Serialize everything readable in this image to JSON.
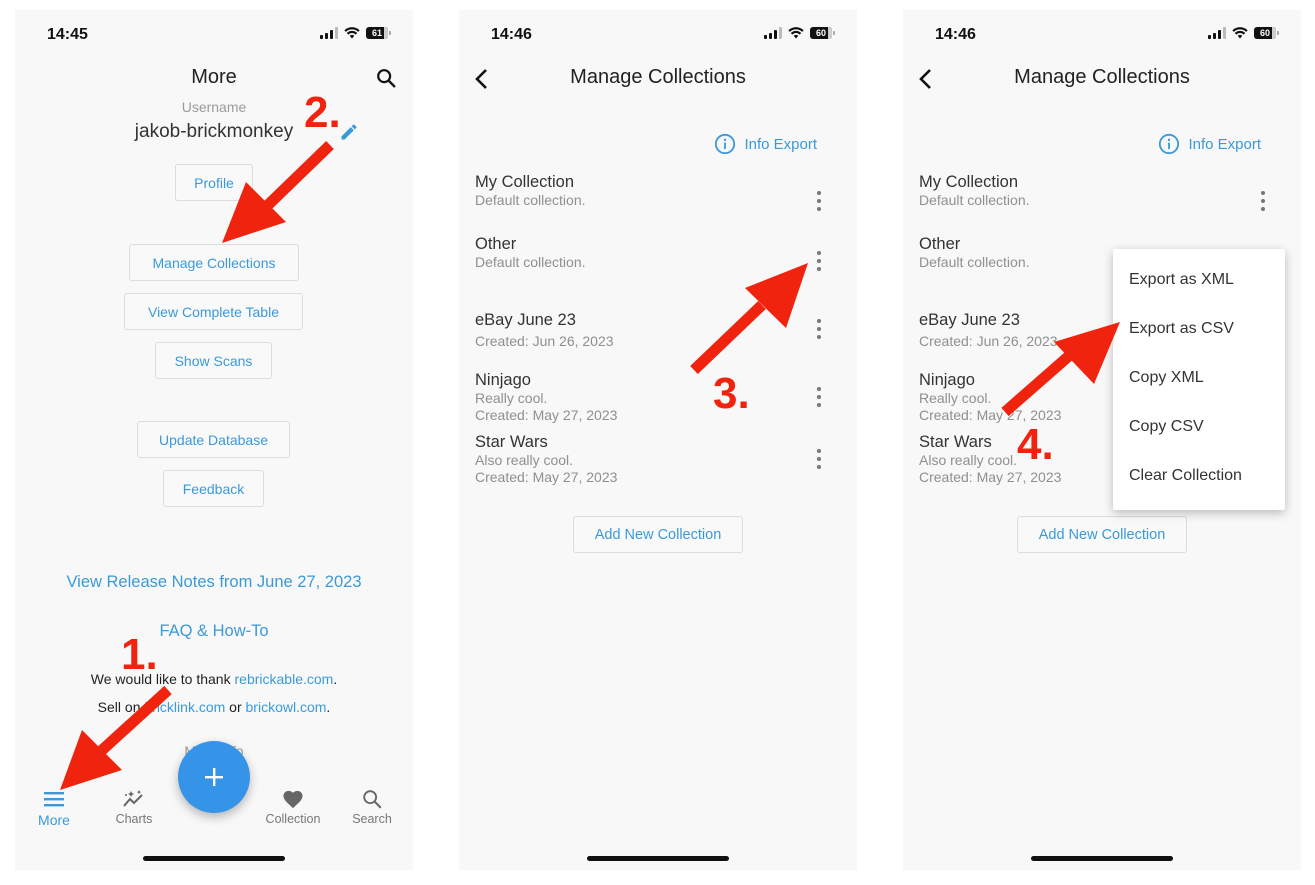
{
  "colors": {
    "accent": "#3a9ad9",
    "fab": "#3593e8",
    "annotation": "#f0230e",
    "screen_bg": "#f8f8f8",
    "muted_text": "#8f8f8f"
  },
  "screens": [
    {
      "status": {
        "time": "14:45",
        "battery": "61"
      },
      "header": {
        "title": "More",
        "search_icon": "search-icon"
      },
      "profile": {
        "username_label": "Username",
        "username": "jakob-brickmonkey",
        "edit_icon": "pencil-icon"
      },
      "buttons": {
        "profile": "Profile",
        "manage_collections": "Manage Collections",
        "view_complete_table": "View Complete Table",
        "show_scans": "Show Scans",
        "update_database": "Update Database",
        "feedback": "Feedback"
      },
      "links": {
        "release_notes": "View Release Notes from June 27, 2023",
        "faq": "FAQ & How-To"
      },
      "credits": {
        "thanks_prefix": "We would like to thank ",
        "thanks_link": "rebrickable.com",
        "thanks_suffix": ".",
        "sell_prefix": "Sell on ",
        "sell_link1": "bricklink.com",
        "sell_mid": " or ",
        "sell_link2": "brickowl.com",
        "sell_suffix": "."
      },
      "more_info": "More Info",
      "bottom_nav": [
        {
          "label": "More",
          "icon": "menu-icon",
          "active": true
        },
        {
          "label": "Charts",
          "icon": "sparkle-chart-icon",
          "active": false
        },
        {
          "label": "Collection",
          "icon": "heart-icon",
          "active": false
        },
        {
          "label": "Search",
          "icon": "search-icon",
          "active": false
        }
      ],
      "fab": {
        "icon": "plus-icon"
      }
    },
    {
      "status": {
        "time": "14:46",
        "battery": "60"
      },
      "header": {
        "title": "Manage Collections",
        "back_icon": "chevron-left-icon"
      },
      "info_export": "Info Export",
      "collections": [
        {
          "name": "My Collection",
          "lines": [
            "Default collection."
          ]
        },
        {
          "name": "Other",
          "lines": [
            "Default collection."
          ]
        },
        {
          "name": "eBay June 23",
          "lines": [
            "Created: Jun 26, 2023"
          ]
        },
        {
          "name": "Ninjago",
          "lines": [
            "Really cool.",
            "Created: May 27, 2023"
          ]
        },
        {
          "name": "Star Wars",
          "lines": [
            "Also really cool.",
            "Created: May 27, 2023"
          ]
        }
      ],
      "add_button": "Add New Collection"
    },
    {
      "status": {
        "time": "14:46",
        "battery": "60"
      },
      "header": {
        "title": "Manage Collections",
        "back_icon": "chevron-left-icon"
      },
      "info_export": "Info Export",
      "collections": [
        {
          "name": "My Collection",
          "lines": [
            "Default collection."
          ]
        },
        {
          "name": "Other",
          "lines": [
            "Default collection."
          ]
        },
        {
          "name": "eBay June 23",
          "lines": [
            "Created: Jun 26, 2023"
          ]
        },
        {
          "name": "Ninjago",
          "lines": [
            "Really cool.",
            "Created: May 27, 2023"
          ]
        },
        {
          "name": "Star Wars",
          "lines": [
            "Also really cool.",
            "Created: May 27, 2023"
          ]
        }
      ],
      "add_button": "Add New Collection",
      "context_menu": {
        "items": [
          "Export as XML",
          "Export as CSV",
          "Copy XML",
          "Copy CSV",
          "Clear Collection"
        ]
      }
    }
  ],
  "annotations": [
    "1.",
    "2.",
    "3.",
    "4."
  ]
}
